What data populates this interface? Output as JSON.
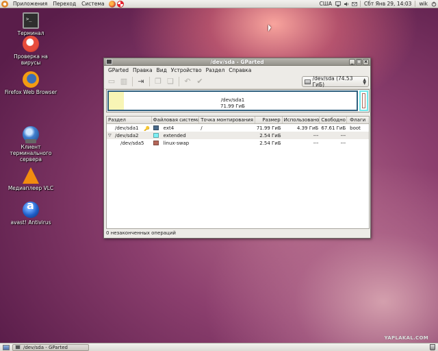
{
  "top_panel": {
    "menus": [
      "Приложения",
      "Переход",
      "Система"
    ],
    "keyboard_layout": "США",
    "datetime": "Сбт Янв 29, 14:03",
    "user": "wik"
  },
  "desktop_icons": [
    {
      "label": "Терминал",
      "icon": "terminal-icon"
    },
    {
      "label": "Проверка на вирусы",
      "icon": "virus-scan-icon"
    },
    {
      "label": "Firefox Web Browser",
      "icon": "firefox-icon"
    },
    {
      "label": "Клиент терминального сервера",
      "icon": "terminal-client-icon"
    },
    {
      "label": "Медиаплеер VLC",
      "icon": "vlc-icon"
    },
    {
      "label": "avast! Antivirus",
      "icon": "avast-icon"
    }
  ],
  "window": {
    "title": "/dev/sda - GParted",
    "menu": [
      "GParted",
      "Правка",
      "Вид",
      "Устройство",
      "Раздел",
      "Справка"
    ],
    "device_selector": "/dev/sda  (74.53 ГиБ)",
    "disk_map": {
      "sda1_name": "/dev/sda1",
      "sda1_size": "71.99 ГиБ",
      "sda1_used_fraction": 0.061
    },
    "columns": [
      "Раздел",
      "Файловая система",
      "Точка монтирования",
      "Размер",
      "Использовано",
      "Свободно",
      "Флаги"
    ],
    "partitions": [
      {
        "name": "/dev/sda1",
        "fs": "ext4",
        "mount": "/",
        "size": "71.99 ГиБ",
        "used": "4.39 ГиБ",
        "free": "67.61 ГиБ",
        "flags": "boot",
        "color": "#4a6a8a"
      },
      {
        "name": "/dev/sda2",
        "fs": "extended",
        "mount": "",
        "size": "2.54 ГиБ",
        "used": "---",
        "free": "---",
        "flags": "",
        "color": "#7ef0f5"
      },
      {
        "name": "/dev/sda5",
        "fs": "linux-swap",
        "mount": "",
        "size": "2.54 ГиБ",
        "used": "---",
        "free": "---",
        "flags": "",
        "color": "#b5675a"
      }
    ],
    "status": "0 незаконченных операций"
  },
  "taskbar": {
    "task": "/dev/sda - GParted"
  },
  "watermark": "YAPLAKAL.COM"
}
